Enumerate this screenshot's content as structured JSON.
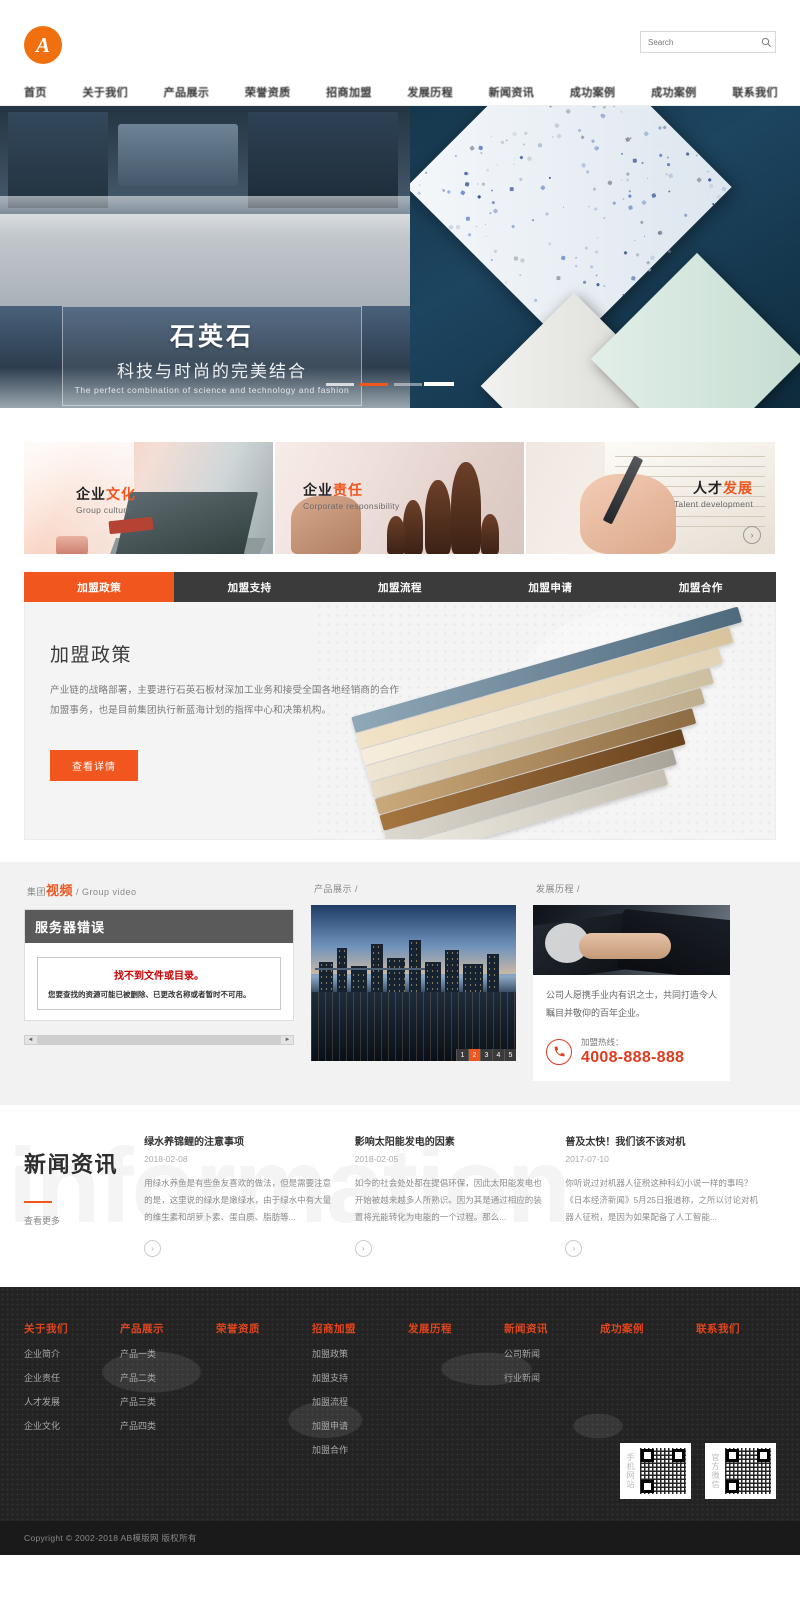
{
  "header": {
    "logo_letter": "A",
    "search": {
      "placeholder": "Search",
      "value": "",
      "icon": "search-icon"
    }
  },
  "nav": {
    "items": [
      {
        "label": "首页"
      },
      {
        "label": "关于我们"
      },
      {
        "label": "产品展示"
      },
      {
        "label": "荣誉资质"
      },
      {
        "label": "招商加盟"
      },
      {
        "label": "发展历程"
      },
      {
        "label": "新闻资讯"
      },
      {
        "label": "成功案例"
      },
      {
        "label": "成功案例"
      },
      {
        "label": "联系我们"
      }
    ]
  },
  "hero": {
    "title": "石英石",
    "subtitle": "科技与时尚的完美结合",
    "tagline": "The perfect combination of science and technology and fashion",
    "slides_total": 3,
    "active_slide": 2
  },
  "features": [
    {
      "title_black": "企业",
      "title_orange": "文化",
      "sub": "Group culture"
    },
    {
      "title_black": "企业",
      "title_orange": "责任",
      "sub": "Corporate responsibility"
    },
    {
      "title_black": "人才",
      "title_orange": "发展",
      "sub": "Talent development"
    }
  ],
  "feature_arrow": "›",
  "join": {
    "tabs": [
      {
        "label": "加盟政策",
        "active": true
      },
      {
        "label": "加盟支持",
        "active": false
      },
      {
        "label": "加盟流程",
        "active": false
      },
      {
        "label": "加盟申请",
        "active": false
      },
      {
        "label": "加盟合作",
        "active": false
      }
    ],
    "panel_title": "加盟政策",
    "panel_line1": "产业链的战略部署，主要进行石英石板材深加工业务和接受全国各地经销商的合作",
    "panel_line2": "加盟事务，也是目前集团执行新蓝海计划的指挥中心和决策机构。",
    "button_label": "查看详情"
  },
  "sections": {
    "video": {
      "title_black": "集团",
      "title_orange": "视频",
      "title_en": "/ Group video",
      "error_header": "服务器错误",
      "error_main": "找不到文件或目录。",
      "error_sub": "您要查找的资源可能已被删除、已更改名称或者暂时不可用。"
    },
    "products": {
      "title": "产品展示",
      "title_en": "/",
      "pager": [
        "1",
        "2",
        "3",
        "4",
        "5"
      ],
      "active_page": "2"
    },
    "history": {
      "title": "发展历程",
      "title_en": "/",
      "body": "公司人愿携手业内有识之士，共同打造令人瞩目并敬仰的百年企业。",
      "hotline_label": "加盟热线：",
      "hotline_number": "4008-888-888",
      "phone_icon": "phone-icon"
    }
  },
  "news": {
    "heading": "新闻资讯",
    "more_label": "查看更多",
    "watermark": "information",
    "arrow": "›",
    "items": [
      {
        "title": "绿水养锦鲤的注意事项",
        "date": "2018-02-08",
        "desc": "用绿水养鱼是有些鱼友喜欢的做法，但是需要注意的是，这里说的绿水是嫩绿水，由于绿水中有大量的维生素和胡萝卜素、蛋白质、脂肪等..."
      },
      {
        "title": "影响太阳能发电的因素",
        "date": "2018-02-05",
        "desc": "如今的社会处处都在提倡环保，因此太阳能发电也开始被越来越多人所熟识。因为其是通过相应的装置将光能转化为电能的一个过程。那么..."
      },
      {
        "title": "普及太快！我们该不该对机",
        "date": "2017-07-10",
        "desc": "你听说过对机器人征税这种科幻小说一样的事吗？《日本经济新闻》5月25日报道称，之所以讨论对机器人征税，是因为如果配备了人工智能..."
      }
    ]
  },
  "footer": {
    "columns": [
      {
        "title": "关于我们",
        "links": [
          "企业简介",
          "企业责任",
          "人才发展",
          "企业文化"
        ]
      },
      {
        "title": "产品展示",
        "links": [
          "产品一类",
          "产品二类",
          "产品三类",
          "产品四类"
        ]
      },
      {
        "title": "荣誉资质",
        "links": []
      },
      {
        "title": "招商加盟",
        "links": [
          "加盟政策",
          "加盟支持",
          "加盟流程",
          "加盟申请",
          "加盟合作"
        ]
      },
      {
        "title": "发展历程",
        "links": []
      },
      {
        "title": "新闻资讯",
        "links": [
          "公司新闻",
          "行业新闻"
        ]
      },
      {
        "title": "成功案例",
        "links": []
      },
      {
        "title": "联系我们",
        "links": []
      }
    ],
    "qr_codes": [
      {
        "label": "手机网站"
      },
      {
        "label": "官方微信"
      }
    ],
    "copyright": "Copyright © 2002-2018 AB模版网 版权所有"
  }
}
